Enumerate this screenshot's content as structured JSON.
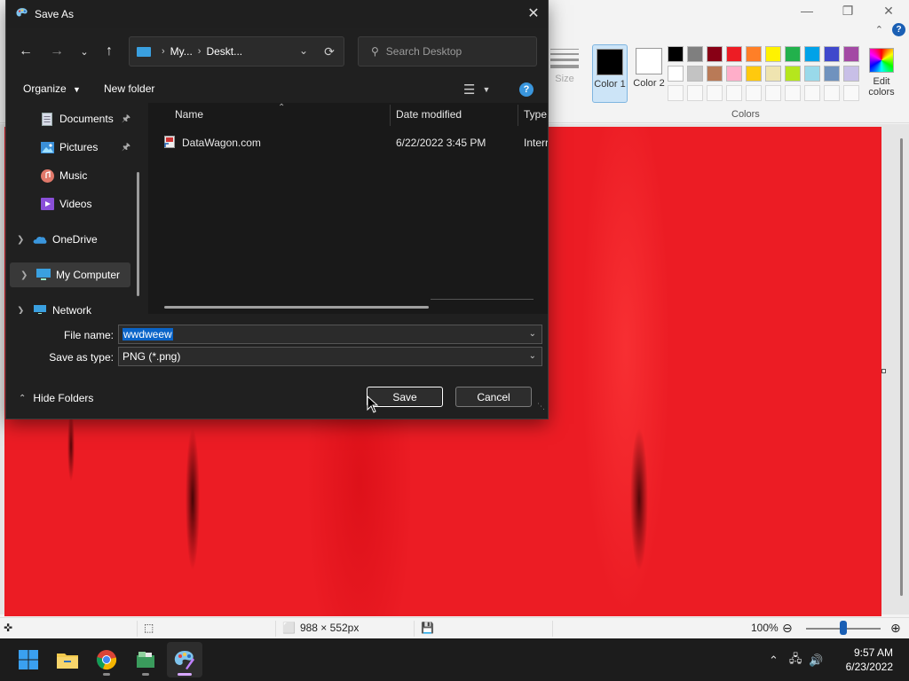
{
  "paint": {
    "size_label": "Size",
    "color1_label": "Color 1",
    "color2_label": "Color 2",
    "color1_value": "#000000",
    "color2_value": "#ffffff",
    "colors_group_label": "Colors",
    "edit_colors_label": "Edit colors",
    "palette": [
      "#000000",
      "#7f7f7f",
      "#880015",
      "#ed1c24",
      "#ff7f27",
      "#fff200",
      "#22b14c",
      "#00a2e8",
      "#3f48cc",
      "#a349a4",
      "#ffffff",
      "#c3c3c3",
      "#b97a57",
      "#ffaec9",
      "#ffc90e",
      "#efe4b0",
      "#b5e61d",
      "#99d9ea",
      "#7092be",
      "#c8bfe7"
    ],
    "canvas_color": "#ec1c24",
    "status": {
      "canvas_size": "988 × 552px",
      "zoom": "100%",
      "zoom_level_percent": 100
    }
  },
  "dialog": {
    "title": "Save As",
    "address": {
      "crumbs": [
        "My...",
        "Deskt..."
      ]
    },
    "search": {
      "placeholder": "Search Desktop"
    },
    "commands": {
      "organize": "Organize",
      "new_folder": "New folder"
    },
    "nav_items": [
      {
        "label": "Documents",
        "icon": "documents-icon",
        "pinned": true
      },
      {
        "label": "Pictures",
        "icon": "pictures-icon",
        "pinned": true
      },
      {
        "label": "Music",
        "icon": "music-icon",
        "pinned": false
      },
      {
        "label": "Videos",
        "icon": "videos-icon",
        "pinned": false
      },
      {
        "label": "OneDrive",
        "icon": "onedrive-icon",
        "pinned": false
      },
      {
        "label": "My Computer",
        "icon": "computer-icon",
        "pinned": false
      },
      {
        "label": "Network",
        "icon": "network-icon",
        "pinned": false
      }
    ],
    "columns": {
      "name": "Name",
      "date": "Date modified",
      "type": "Type"
    },
    "files": [
      {
        "name": "DataWagon.com",
        "date": "6/22/2022 3:45 PM",
        "type": "Interr"
      }
    ],
    "file_name_label": "File name:",
    "file_name_value": "wwdweew",
    "save_type_label": "Save as type:",
    "save_type_value": "PNG (*.png)",
    "hide_folders": "Hide Folders",
    "save_button": "Save",
    "cancel_button": "Cancel"
  },
  "taskbar": {
    "apps": [
      "start-icon",
      "file-explorer-icon",
      "chrome-icon",
      "file-app-icon",
      "paint-icon"
    ],
    "time": "9:57 AM",
    "date": "6/23/2022"
  }
}
